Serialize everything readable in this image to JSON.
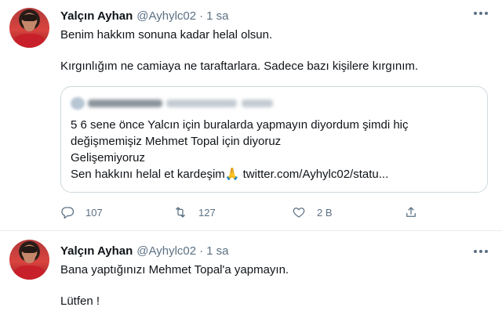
{
  "tweets": [
    {
      "author": {
        "name": "Yalçın Ayhan",
        "handle": "@Ayhylc02",
        "separator": "·",
        "time": "1 sa"
      },
      "lines": [
        "Benim hakkım sonuna kadar helal olsun.",
        "Kırgınlığım ne camiaya ne taraftarlara. Sadece bazı kişilere kırgınım."
      ],
      "quote": {
        "lines": [
          "5 6 sene önce Yalcın için buralarda yapmayın diyordum şimdi hiç",
          "değişmemişiz Mehmet Topal için diyoruz",
          "Gelişemiyoruz",
          "Sen hakkını helal et kardeşim🙏 twitter.com/Ayhylc02/statu..."
        ]
      },
      "actions": {
        "reply_count": "107",
        "retweet_count": "127",
        "like_count": "2 B"
      }
    },
    {
      "author": {
        "name": "Yalçın Ayhan",
        "handle": "@Ayhylc02",
        "separator": "·",
        "time": "1 sa"
      },
      "lines": [
        "Bana yaptığınızı Mehmet Topal'a yapmayın.",
        "Lütfen !"
      ]
    }
  ],
  "icons": [
    "more-icon",
    "reply-icon",
    "retweet-icon",
    "like-icon",
    "share-icon"
  ],
  "colors": {
    "text": "#0f1419",
    "secondary": "#5b7083",
    "border": "#cfd9de"
  }
}
